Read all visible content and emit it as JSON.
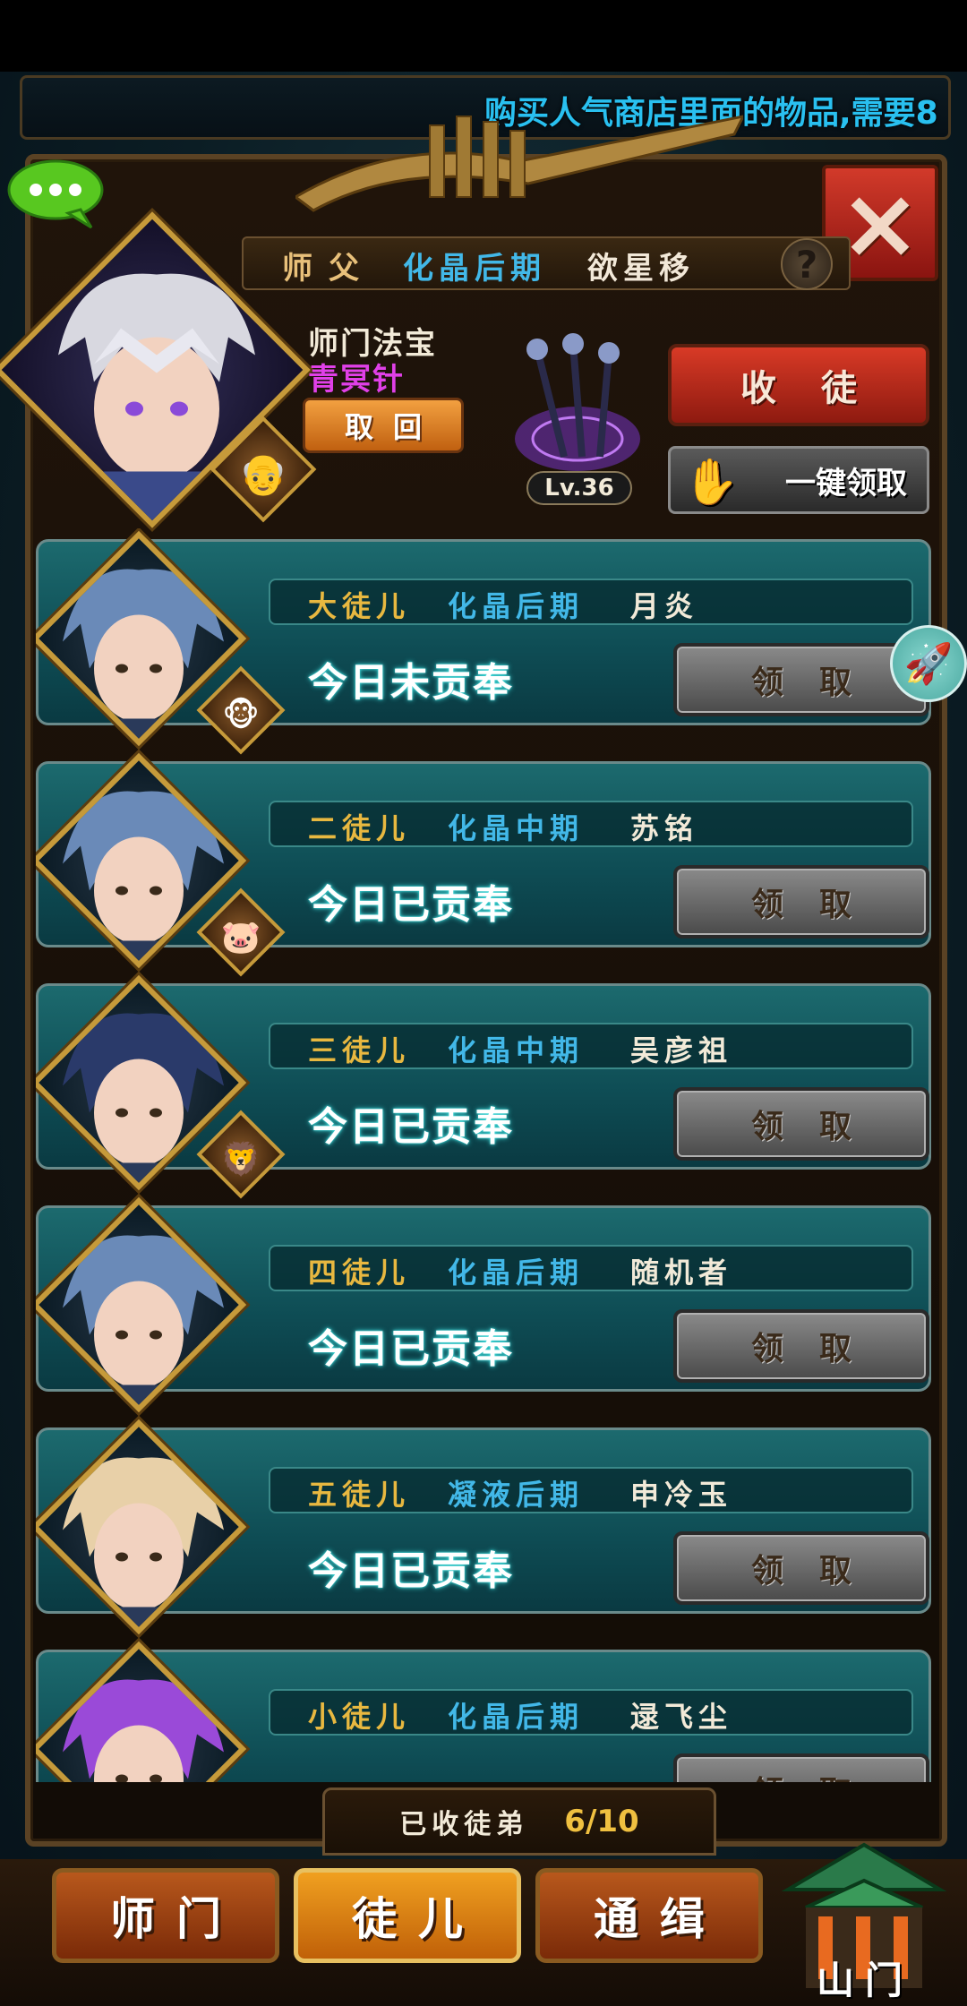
{
  "marquee": {
    "text": "购买人气商店里面的物品,需要8"
  },
  "master": {
    "label": "师父",
    "stage": "化晶后期",
    "name": "欲星移",
    "help": "?",
    "treasure_title": "师门法宝",
    "treasure_name": "青冥针",
    "retrieve_label": "取回",
    "treasure_level": "Lv.36"
  },
  "actions": {
    "recruit_label": "收徒",
    "oneclick_label": "一键领取",
    "close_icon": "×"
  },
  "disciples": [
    {
      "rank": "大徒儿",
      "stage": "化晶后期",
      "name": "月炎",
      "status": "今日未贡奉",
      "claim_label": "领取",
      "pet": "🐵",
      "hair": "#6a8ab8"
    },
    {
      "rank": "二徒儿",
      "stage": "化晶中期",
      "name": "苏铭",
      "status": "今日已贡奉",
      "claim_label": "领取",
      "pet": "🐷",
      "hair": "#6a8ab8"
    },
    {
      "rank": "三徒儿",
      "stage": "化晶中期",
      "name": "吴彦祖",
      "status": "今日已贡奉",
      "claim_label": "领取",
      "pet": "🦁",
      "hair": "#2a3a6a"
    },
    {
      "rank": "四徒儿",
      "stage": "化晶后期",
      "name": "随机者",
      "status": "今日已贡奉",
      "claim_label": "领取",
      "pet": "",
      "hair": "#6a8ab8"
    },
    {
      "rank": "五徒儿",
      "stage": "凝液后期",
      "name": "申冷玉",
      "status": "今日已贡奉",
      "claim_label": "领取",
      "pet": "",
      "hair": "#e8d0a8"
    },
    {
      "rank": "小徒儿",
      "stage": "化晶后期",
      "name": "逯飞尘",
      "status": "",
      "claim_label": "领取",
      "pet": "",
      "hair": "#9a4ad8"
    }
  ],
  "recruited": {
    "label": "已收徒弟",
    "count": "6/10"
  },
  "tabs": {
    "master": "师门",
    "disciple": "徒儿",
    "wanted": "通缉",
    "mountain_gate": "山门"
  },
  "colors": {
    "rank": "#e8b840",
    "stage": "#42b8e8",
    "treasure": "#e040e8",
    "marquee": "#29c0f0"
  }
}
